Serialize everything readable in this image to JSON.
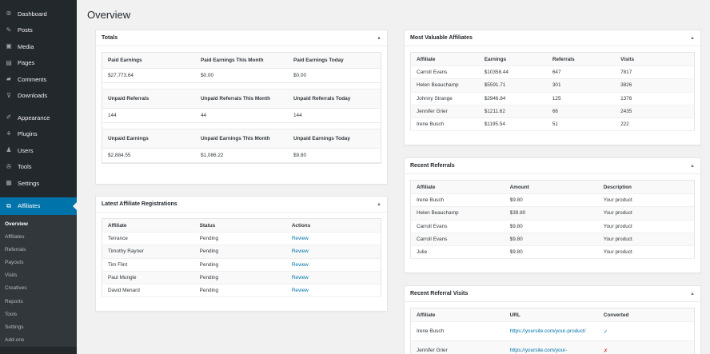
{
  "sidebar": {
    "top_items": [
      {
        "label": "Dashboard",
        "icon": "dashboard-icon",
        "glyph": "⊚"
      },
      {
        "label": "Posts",
        "icon": "pin-icon",
        "glyph": "✎"
      },
      {
        "label": "Media",
        "icon": "media-icon",
        "glyph": "▣"
      },
      {
        "label": "Pages",
        "icon": "page-icon",
        "glyph": "▤"
      },
      {
        "label": "Comments",
        "icon": "comment-icon",
        "glyph": "▰"
      },
      {
        "label": "Downloads",
        "icon": "download-icon",
        "glyph": "⊽"
      },
      {
        "label": "Appearance",
        "icon": "brush-icon",
        "glyph": "✐"
      },
      {
        "label": "Plugins",
        "icon": "plugin-icon",
        "glyph": "⚘"
      },
      {
        "label": "Users",
        "icon": "users-icon",
        "glyph": "♟"
      },
      {
        "label": "Tools",
        "icon": "wrench-icon",
        "glyph": "✇"
      },
      {
        "label": "Settings",
        "icon": "settings-icon",
        "glyph": "▦"
      }
    ],
    "active": {
      "label": "Affiliates",
      "icon": "affiliates-icon",
      "glyph": "⧉"
    },
    "submenu": [
      "Overview",
      "Affiliates",
      "Referrals",
      "Payouts",
      "Visits",
      "Creatives",
      "Reports",
      "Tools",
      "Settings",
      "Add-ons"
    ]
  },
  "page_title": "Overview",
  "totals": {
    "title": "Totals",
    "toggle": "▲",
    "groups": [
      {
        "headers": [
          "Paid Earnings",
          "Paid Earnings This Month",
          "Paid Earnings Today"
        ],
        "values": [
          "$27,773.64",
          "$0.00",
          "$0.00"
        ]
      },
      {
        "headers": [
          "Unpaid Referrals",
          "Unpaid Referrals This Month",
          "Unpaid Referrals Today"
        ],
        "values": [
          "144",
          "44",
          "144"
        ]
      },
      {
        "headers": [
          "Unpaid Earnings",
          "Unpaid Earnings This Month",
          "Unpaid Earnings Today"
        ],
        "values": [
          "$2,884.55",
          "$1,086.22",
          "$9.80"
        ]
      }
    ]
  },
  "registrations": {
    "title": "Latest Affiliate Registrations",
    "toggle": "▲",
    "columns": [
      "Affiliate",
      "Status",
      "Actions"
    ],
    "rows": [
      [
        "Terrance",
        "Pending",
        "Review"
      ],
      [
        "Timothy Rayner",
        "Pending",
        "Review"
      ],
      [
        "Tim Flint",
        "Pending",
        "Review"
      ],
      [
        "Paul Mungle",
        "Pending",
        "Review"
      ],
      [
        "David Menard",
        "Pending",
        "Review"
      ]
    ]
  },
  "valuable": {
    "title": "Most Valuable Affiliates",
    "toggle": "▲",
    "columns": [
      "Affiliate",
      "Earnings",
      "Referrals",
      "Visits"
    ],
    "rows": [
      [
        "Carroll Evans",
        "$10358.44",
        "647",
        "7817"
      ],
      [
        "Helen Beauchamp",
        "$5591.71",
        "301",
        "3826"
      ],
      [
        "Johnny Strange",
        "$2946.84",
        "125",
        "1376"
      ],
      [
        "Jennifer Grier",
        "$1211.62",
        "66",
        "2435"
      ],
      [
        "Irene Busch",
        "$1195.54",
        "51",
        "222"
      ]
    ]
  },
  "referrals": {
    "title": "Recent Referrals",
    "toggle": "▲",
    "columns": [
      "Affiliate",
      "Amount",
      "Description"
    ],
    "rows": [
      [
        "Irene Busch",
        "$9.80",
        "Your product"
      ],
      [
        "Helen Beauchamp",
        "$39.80",
        "Your product"
      ],
      [
        "Carroll Evans",
        "$9.80",
        "Your product"
      ],
      [
        "Carroll Evans",
        "$9.80",
        "Your product"
      ],
      [
        "Julie",
        "$9.80",
        "Your product"
      ]
    ]
  },
  "visits": {
    "title": "Recent Referral Visits",
    "toggle": "▲",
    "columns": [
      "Affiliate",
      "URL",
      "Converted"
    ],
    "rows": [
      {
        "affiliate": "Irene Busch",
        "url": "https://yoursite.com/your-product/",
        "converted": "✓",
        "converted_state": "yes"
      },
      {
        "affiliate": "Jennifer Grier",
        "url": "https://yoursite.com/your-",
        "converted": "✗",
        "converted_state": "no"
      }
    ]
  },
  "colors": {
    "sidebar": "#23282d",
    "accent": "#0073aa",
    "background": "#f1f1f1",
    "cross": "#dc3232"
  }
}
